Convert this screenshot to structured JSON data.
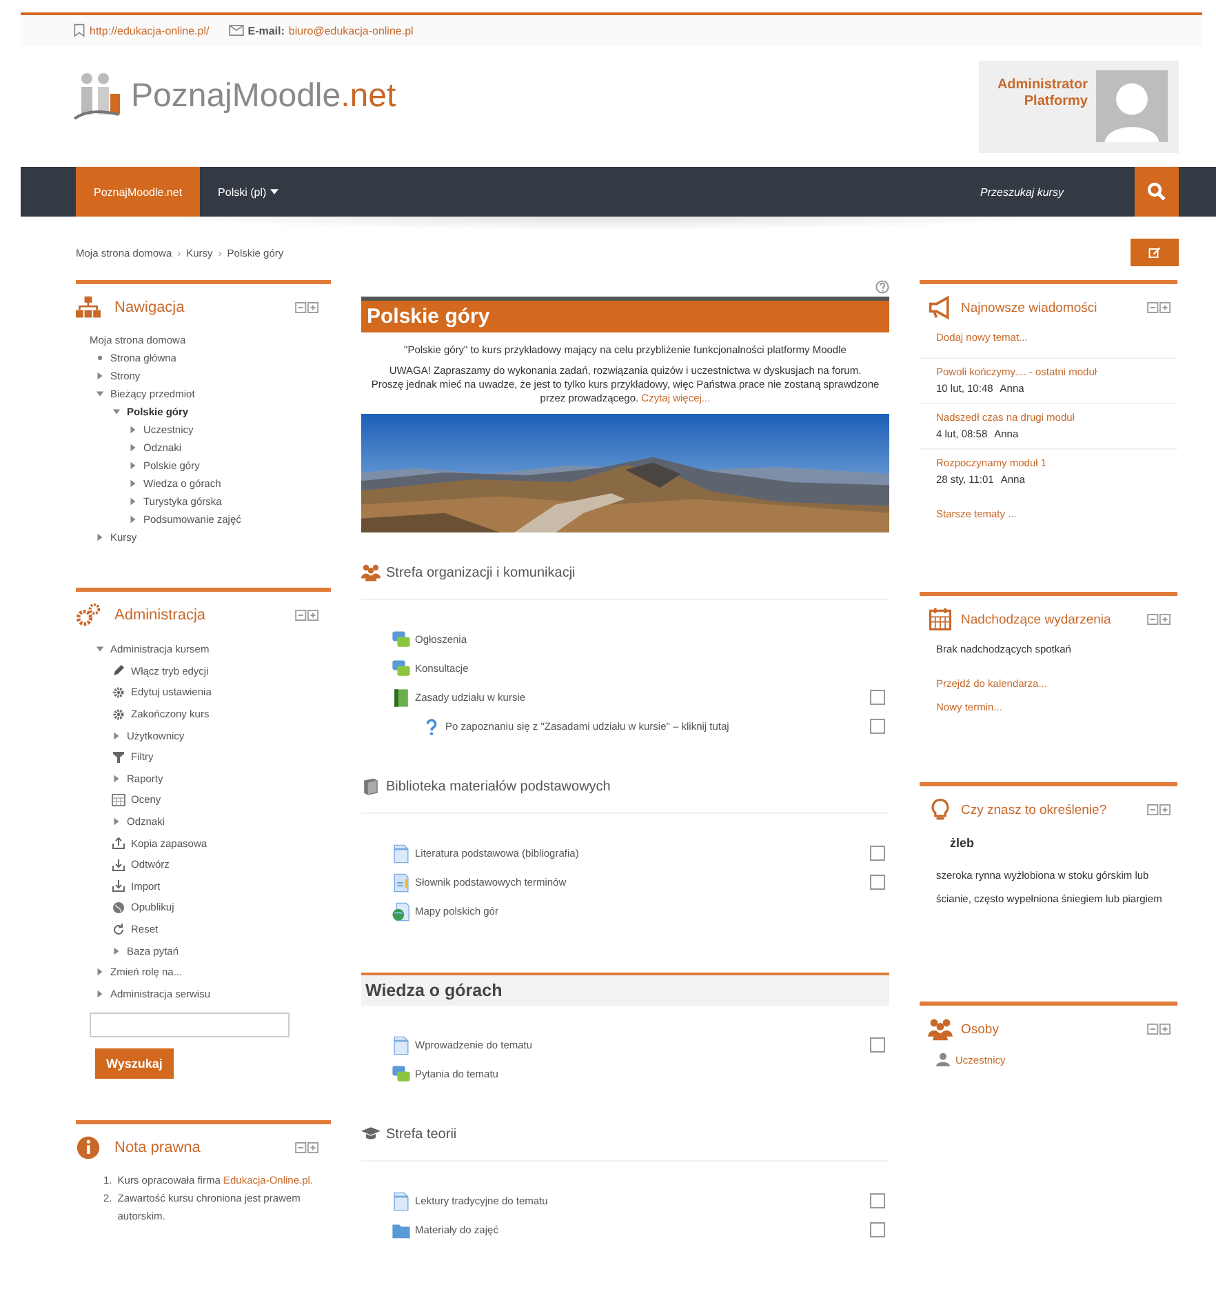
{
  "topbar": {
    "website": "http://edukacja-online.pl/",
    "email_label": "E-mail:",
    "email": "biuro@edukacja-online.pl"
  },
  "logo": {
    "main": "PoznajMoodle",
    "accent": ".net"
  },
  "user": {
    "name_lines": [
      "Administrator",
      "Platformy"
    ]
  },
  "navbar": {
    "items": [
      {
        "label": "PoznajMoodle.net",
        "kind": "link",
        "selected": true
      },
      {
        "label": "Polski (pl)",
        "kind": "dropdown",
        "selected": false
      }
    ],
    "search_placeholder": "Przeszukaj kursy"
  },
  "breadcrumb": {
    "separator": "›",
    "items": [
      "Moja strona domowa",
      "Kursy",
      "Polskie góry"
    ]
  },
  "navigation": {
    "title": "Nawigacja",
    "items": [
      {
        "label": "Moja strona domowa",
        "kind": "plain"
      },
      {
        "label": "Strona główna",
        "kind": "leaf"
      },
      {
        "label": "Strony",
        "kind": "branch",
        "expanded": false
      },
      {
        "label": "Bieżący przedmiot",
        "kind": "branch",
        "expanded": true,
        "children": [
          {
            "label": "Polskie góry",
            "kind": "branch",
            "expanded": true,
            "bold": true,
            "children": [
              {
                "label": "Uczestnicy",
                "kind": "branch",
                "expanded": false
              },
              {
                "label": "Odznaki",
                "kind": "branch",
                "expanded": false
              },
              {
                "label": "Polskie góry",
                "kind": "branch",
                "expanded": false
              },
              {
                "label": "Wiedza o górach",
                "kind": "branch",
                "expanded": false
              },
              {
                "label": "Turystyka górska",
                "kind": "branch",
                "expanded": false
              },
              {
                "label": "Podsumowanie zajęć",
                "kind": "branch",
                "expanded": false
              }
            ]
          }
        ]
      },
      {
        "label": "Kursy",
        "kind": "branch",
        "expanded": false
      }
    ]
  },
  "administration": {
    "title": "Administracja",
    "items": [
      {
        "label": "Administracja kursem",
        "kind": "branch",
        "expanded": true,
        "children": [
          {
            "label": "Włącz tryb edycji",
            "kind": "pencil"
          },
          {
            "label": "Edytuj ustawienia",
            "kind": "gear"
          },
          {
            "label": "Zakończony kurs",
            "kind": "gear"
          },
          {
            "label": "Użytkownicy",
            "kind": "branch",
            "expanded": false
          },
          {
            "label": "Filtry",
            "kind": "filter"
          },
          {
            "label": "Raporty",
            "kind": "branch",
            "expanded": false
          },
          {
            "label": "Oceny",
            "kind": "grades"
          },
          {
            "label": "Odznaki",
            "kind": "branch",
            "expanded": false
          },
          {
            "label": "Kopia zapasowa",
            "kind": "upload"
          },
          {
            "label": "Odtwórz",
            "kind": "download"
          },
          {
            "label": "Import",
            "kind": "download"
          },
          {
            "label": "Opublikuj",
            "kind": "globe"
          },
          {
            "label": "Reset",
            "kind": "reset"
          },
          {
            "label": "Baza pytań",
            "kind": "branch",
            "expanded": false
          }
        ]
      },
      {
        "label": "Zmień rolę na...",
        "kind": "branch",
        "expanded": false
      },
      {
        "label": "Administracja serwisu",
        "kind": "branch",
        "expanded": false
      }
    ],
    "search_button": "Wyszukaj"
  },
  "legal": {
    "title": "Nota prawna",
    "items": [
      {
        "number": "1.",
        "text": "Kurs opracowała firma ",
        "link": "Edukacja-Online.pl."
      },
      {
        "number": "2.",
        "text": "Zawartość kursu chroniona jest prawem autorskim."
      }
    ]
  },
  "course": {
    "title": "Polskie góry",
    "intro": "\"Polskie góry\" to kurs przykładowy mający na celu przybliżenie funkcjonalności platformy Moodle",
    "notice": "UWAGA! Zapraszamy do wykonania zadań, rozwiązania quizów i uczestnictwa w dyskusjach na forum.",
    "notice2": "Proszę jednak mieć na uwadze, że jest to tylko kurs przykładowy, więc Państwa prace nie zostaną sprawdzone przez prowadzącego.",
    "read_more": "Czytaj więcej..."
  },
  "sections": [
    {
      "kind": "label",
      "title": "Strefa organizacji i komunikacji",
      "activities": [
        {
          "label": "Ogłoszenia",
          "kind": "forum"
        },
        {
          "label": "Konsultacje",
          "kind": "forum"
        },
        {
          "label": "Zasady udziału w kursie",
          "kind": "book",
          "checked": false,
          "children": [
            {
              "label": "Po zapoznaniu się z \"Zasadami udziału w kursie\" – kliknij tutaj",
              "kind": "question",
              "checked": false
            }
          ]
        }
      ]
    },
    {
      "kind": "label",
      "title": "Biblioteka materiałów podstawowych",
      "activities": [
        {
          "label": "Literatura podstawowa (bibliografia)",
          "kind": "page",
          "checked": false
        },
        {
          "label": "Słownik podstawowych terminów",
          "kind": "glossary",
          "checked": false
        },
        {
          "label": "Mapy polskich gór",
          "kind": "url"
        }
      ]
    },
    {
      "kind": "topic",
      "title": "Wiedza o górach",
      "activities": [
        {
          "label": "Wprowadzenie do tematu",
          "kind": "page",
          "checked": false
        },
        {
          "label": "Pytania do tematu",
          "kind": "forum"
        }
      ]
    },
    {
      "kind": "label",
      "title": "Strefa teorii",
      "activities": [
        {
          "label": "Lektury tradycyjne do tematu",
          "kind": "page",
          "checked": false
        },
        {
          "label": "Materiały do zajęć",
          "kind": "folder",
          "checked": false
        }
      ]
    }
  ],
  "news": {
    "title": "Najnowsze wiadomości",
    "add_link": "Dodaj nowy temat...",
    "posts": [
      {
        "title": "Powoli kończymy.... - ostatni moduł",
        "date": "10 lut, 10:48",
        "author": "Anna"
      },
      {
        "title": "Nadszedł czas na drugi moduł",
        "date": "4 lut, 08:58",
        "author": "Anna"
      },
      {
        "title": "Rozpoczynamy moduł 1",
        "date": "28 sty, 11:01",
        "author": "Anna"
      }
    ],
    "older_link": "Starsze tematy ..."
  },
  "events": {
    "title": "Nadchodzące wydarzenia",
    "empty_text": "Brak nadchodzących spotkań",
    "links": [
      "Przejdź do kalendarza...",
      "Nowy termin..."
    ]
  },
  "glossary": {
    "title": "Czy znasz to określenie?",
    "term": "żleb",
    "definition": "szeroka rynna wyżłobiona w stoku górskim lub ścianie, często wypełniona śniegiem lub piargiem"
  },
  "people": {
    "title": "Osoby",
    "link": "Uczestnicy"
  }
}
